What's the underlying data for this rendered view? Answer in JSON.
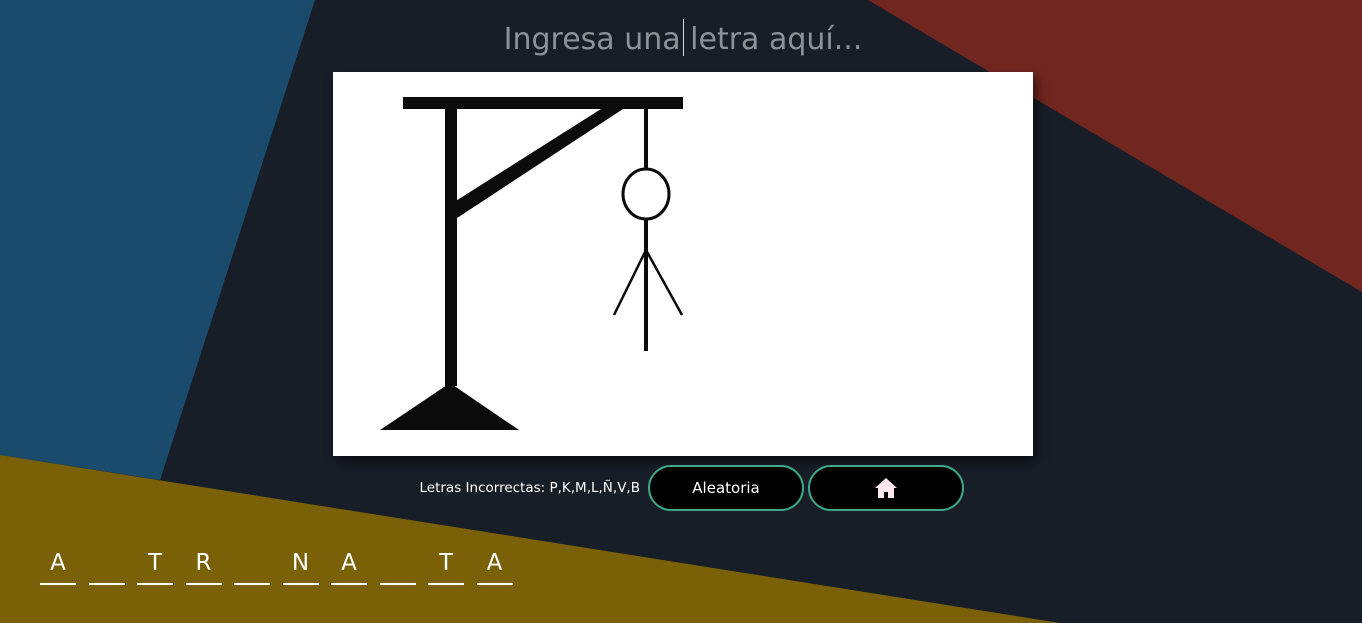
{
  "input": {
    "placeholder": "Ingresa una letra aquí..."
  },
  "status": {
    "wrong_letters": "Letras Incorrectas: P,K,M,L,Ñ,V,B"
  },
  "buttons": {
    "random_label": "Aleatoria",
    "home_icon": "home-icon"
  },
  "word": {
    "slots": [
      "A",
      "",
      "T",
      "R",
      "",
      "N",
      "A",
      "",
      "T",
      "A"
    ]
  },
  "colors": {
    "background": "#171e27",
    "blue_panel": "#1b4b6c",
    "red_panel": "#722620",
    "gold_panel": "#7a6108",
    "button_border": "#3fa889",
    "home_icon": "#fbe6ea"
  }
}
